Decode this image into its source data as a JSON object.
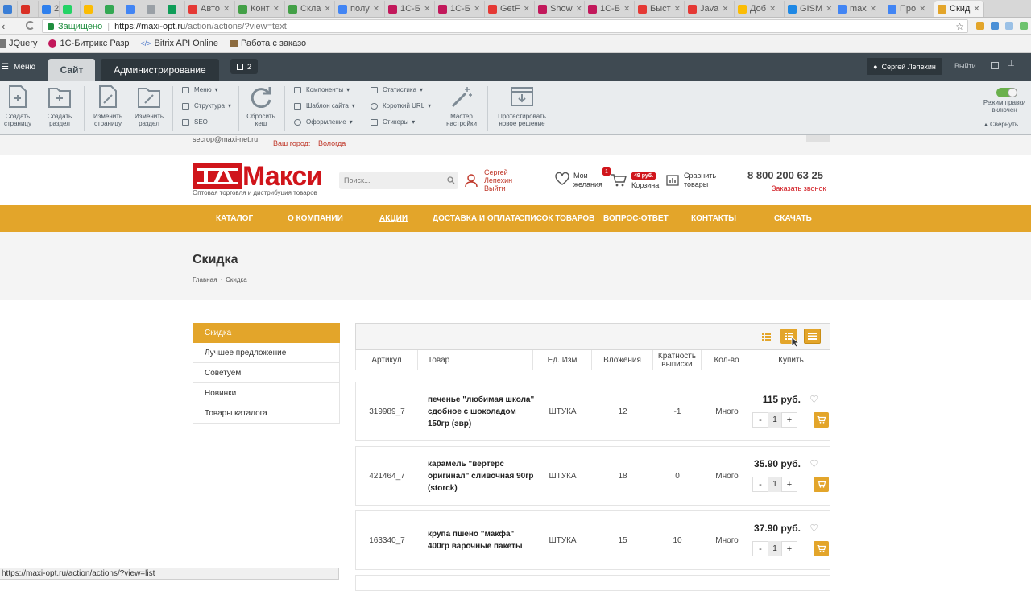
{
  "browser": {
    "tabs": [
      {
        "label": "",
        "color": "#3a7ed6"
      },
      {
        "label": "",
        "color": "#d93025"
      },
      {
        "label": "24",
        "color": "#2f80ed"
      },
      {
        "label": "",
        "color": "#25d366"
      },
      {
        "label": "",
        "color": "#fbbc04"
      },
      {
        "label": "",
        "color": "#34a853"
      },
      {
        "label": "",
        "color": "#4285f4"
      },
      {
        "label": "",
        "color": "#9aa0a6"
      },
      {
        "label": "",
        "color": "#0f9d58"
      },
      {
        "label": "Авто",
        "color": "#e53935"
      },
      {
        "label": "Конт",
        "color": "#43a047"
      },
      {
        "label": "Скла",
        "color": "#43a047"
      },
      {
        "label": "полу",
        "color": "#4285f4"
      },
      {
        "label": "1С-Б",
        "color": "#c2185b"
      },
      {
        "label": "1С-Б",
        "color": "#c2185b"
      },
      {
        "label": "GetF",
        "color": "#e53935"
      },
      {
        "label": "Show",
        "color": "#c2185b"
      },
      {
        "label": "1С-Б",
        "color": "#c2185b"
      },
      {
        "label": "Быст",
        "color": "#e53935"
      },
      {
        "label": "Java",
        "color": "#e53935"
      },
      {
        "label": "Доб",
        "color": "#fbbc04"
      },
      {
        "label": "GISM",
        "color": "#1e88e5"
      },
      {
        "label": "max",
        "color": "#4285f4"
      },
      {
        "label": "Про",
        "color": "#4285f4"
      },
      {
        "label": "Скид",
        "color": "#e3a52a"
      }
    ],
    "url_secure_label": "Защищено",
    "url_host": "https://maxi-opt.ru",
    "url_path": "/action/actions/?view=text",
    "bookmarks": [
      "JQuery",
      "1С-Битрикс Разр",
      "Bitrix API Online",
      "Работа с заказо"
    ],
    "status_url": "https://maxi-opt.ru/action/actions/?view=list"
  },
  "admin": {
    "menu_label": "Меню",
    "tab_site": "Сайт",
    "tab_admin": "Администрирование",
    "notifications": "2",
    "user": "Сергей Лепехин",
    "logout": "Выйти",
    "tools": {
      "create_page": [
        "Создать",
        "страницу"
      ],
      "create_section": [
        "Создать",
        "раздел"
      ],
      "edit_page": [
        "Изменить",
        "страницу"
      ],
      "edit_section": [
        "Изменить",
        "раздел"
      ],
      "menu": "Меню",
      "structure": "Структура",
      "seo": "SEO",
      "reset_cache": [
        "Сбросить",
        "кеш"
      ],
      "components": "Компоненты",
      "template": "Шаблон сайта",
      "design": "Оформление",
      "stats": "Статистика",
      "short_url": "Короткий URL",
      "stickers": "Стикеры",
      "wizard": [
        "Мастер",
        "настройки"
      ],
      "test_solution": [
        "Протестировать",
        "новое решение"
      ],
      "edit_mode": [
        "Режим правки",
        "включен"
      ],
      "collapse": "Свернуть"
    }
  },
  "site": {
    "email": "secrop@maxi-net.ru",
    "city_label": "Ваш город:",
    "city": "Вологда",
    "logo_text": "Макси",
    "logo_sub": "Оптовая торговля и дистрибуция товаров",
    "search_placeholder": "Поиск...",
    "user_name_1": "Сергей",
    "user_name_2": "Лепехин",
    "user_logout": "Выйти",
    "wishlist": [
      "Мои",
      "желания"
    ],
    "wishlist_count": "1",
    "cart_amount": "49 руб.",
    "cart_label": "Корзина",
    "compare": [
      "Сравнить",
      "товары"
    ],
    "phone": "8 800 200 63 25",
    "callback": "Заказать звонок",
    "nav": [
      "Каталог",
      "О компании",
      "Акции",
      "Доставка и оплата",
      "Список товаров",
      "Вопрос-ответ",
      "Контакты",
      "Скачать"
    ],
    "page_title": "Скидка",
    "breadcrumb_home": "Главная",
    "breadcrumb_current": "Скидка",
    "sidebar": [
      "Скидка",
      "Лучшее предложение",
      "Советуем",
      "Новинки",
      "Товары каталога"
    ],
    "table_headers": {
      "sku": "Артикул",
      "product": "Товар",
      "unit": "Ед. Изм",
      "pack": "Вложения",
      "multiplicity": [
        "Кратность",
        "выписки"
      ],
      "qty": "Кол-во",
      "buy": "Купить"
    },
    "products": [
      {
        "sku": "319989_7",
        "name": [
          "печенье \"любимая школа\"",
          "сдобное с шоколадом",
          "150гр (эвр)"
        ],
        "unit": "ШТУКА",
        "pack": "12",
        "mult": "-1",
        "stock": "Много",
        "price": "115 руб.",
        "qty": "1"
      },
      {
        "sku": "421464_7",
        "name": [
          "карамель \"вертерс",
          "оригинал\" сливочная 90гр",
          "(storck)"
        ],
        "unit": "ШТУКА",
        "pack": "18",
        "mult": "0",
        "stock": "Много",
        "price": "35.90 руб.",
        "qty": "1"
      },
      {
        "sku": "163340_7",
        "name": [
          "крупа пшено \"макфа\"",
          "400гр варочные пакеты"
        ],
        "unit": "ШТУКА",
        "pack": "15",
        "mult": "10",
        "stock": "Много",
        "price": "37.90 руб.",
        "qty": "1"
      }
    ]
  },
  "colors": {
    "accent": "#e3a52a",
    "admin_bar": "#3f4a52",
    "logo_red": "#d0151b"
  }
}
